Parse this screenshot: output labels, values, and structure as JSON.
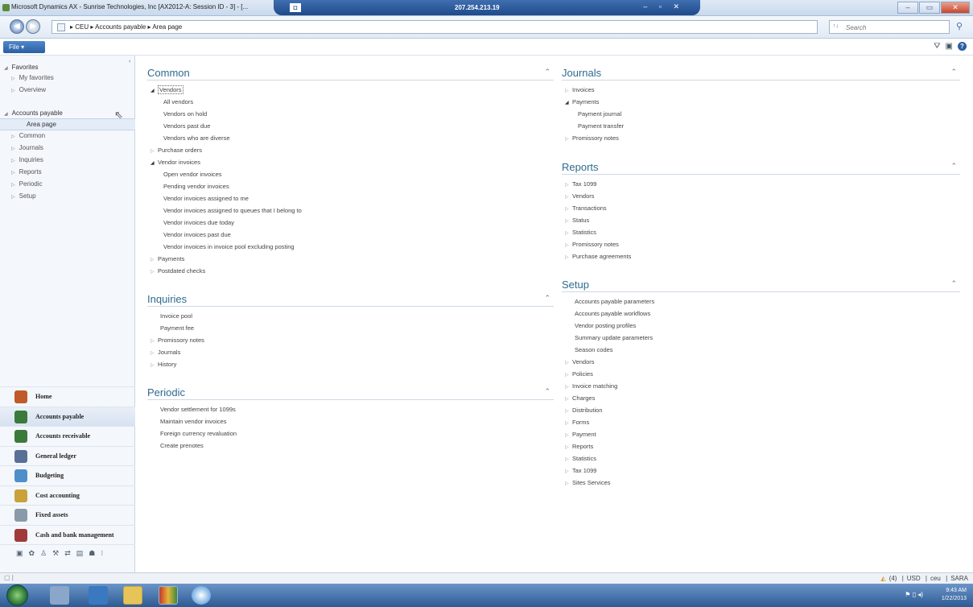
{
  "window": {
    "title": "Microsoft Dynamics AX - Sunrise Technologies, Inc [AX2012-A: Session ID - 3] - [...",
    "rdp_ip": "207.254.213.19",
    "controls": [
      "–",
      "▭",
      "✕"
    ]
  },
  "address": {
    "breadcrumb": "▸  CEU  ▸  Accounts payable  ▸  Area page",
    "search_placeholder": "Search"
  },
  "file_button": "File  ▾",
  "nav": {
    "favorites_group": "Favorites",
    "favorites_items": [
      "My favorites",
      "Overview"
    ],
    "module_group": "Accounts payable",
    "module_items": [
      "Area page",
      "Common",
      "Journals",
      "Inquiries",
      "Reports",
      "Periodic",
      "Setup"
    ]
  },
  "modules": [
    {
      "label": "Home",
      "color": "#c05a2a"
    },
    {
      "label": "Accounts payable",
      "color": "#3a7a3a"
    },
    {
      "label": "Accounts receivable",
      "color": "#3a7a3a"
    },
    {
      "label": "General ledger",
      "color": "#5a6f96"
    },
    {
      "label": "Budgeting",
      "color": "#4f8fc9"
    },
    {
      "label": "Cost accounting",
      "color": "#c9a23a"
    },
    {
      "label": "Fixed assets",
      "color": "#8a9aa8"
    },
    {
      "label": "Cash and bank management",
      "color": "#a03a3a"
    }
  ],
  "sections": {
    "common": {
      "title": "Common",
      "rows": [
        {
          "text": "Vendors",
          "level": "l0",
          "tri": "◢",
          "boxed": true
        },
        {
          "text": "All vendors",
          "level": "l1"
        },
        {
          "text": "Vendors on hold",
          "level": "l1"
        },
        {
          "text": "Vendors past due",
          "level": "l1"
        },
        {
          "text": "Vendors who are diverse",
          "level": "l1"
        },
        {
          "text": "Purchase orders",
          "level": "l0",
          "tri": "▷"
        },
        {
          "text": "Vendor invoices",
          "level": "l0",
          "tri": "◢"
        },
        {
          "text": "Open vendor invoices",
          "level": "l1"
        },
        {
          "text": "Pending vendor invoices",
          "level": "l1"
        },
        {
          "text": "Vendor invoices assigned to me",
          "level": "l1"
        },
        {
          "text": "Vendor invoices assigned to queues that I belong to",
          "level": "l1"
        },
        {
          "text": "Vendor invoices due today",
          "level": "l1"
        },
        {
          "text": "Vendor invoices past due",
          "level": "l1"
        },
        {
          "text": "Vendor invoices in invoice pool excluding posting",
          "level": "l1"
        },
        {
          "text": "Payments",
          "level": "l0",
          "tri": "▷"
        },
        {
          "text": "Postdated checks",
          "level": "l0",
          "tri": "▷"
        }
      ]
    },
    "inquiries": {
      "title": "Inquiries",
      "rows": [
        {
          "text": "Invoice pool",
          "level": "plain"
        },
        {
          "text": "Payment fee",
          "level": "plain"
        },
        {
          "text": "Promissory notes",
          "level": "l0",
          "tri": "▷"
        },
        {
          "text": "Journals",
          "level": "l0",
          "tri": "▷"
        },
        {
          "text": "History",
          "level": "l0",
          "tri": "▷"
        }
      ]
    },
    "periodic": {
      "title": "Periodic",
      "rows": [
        {
          "text": "Vendor settlement for 1099s",
          "level": "plain"
        },
        {
          "text": "Maintain vendor invoices",
          "level": "plain"
        },
        {
          "text": "Foreign currency revaluation",
          "level": "plain"
        },
        {
          "text": "Create prenotes",
          "level": "plain"
        }
      ]
    },
    "journals": {
      "title": "Journals",
      "rows": [
        {
          "text": "Invoices",
          "level": "l0",
          "tri": "▷"
        },
        {
          "text": "Payments",
          "level": "l0",
          "tri": "◢"
        },
        {
          "text": "Payment journal",
          "level": "l1"
        },
        {
          "text": "Payment transfer",
          "level": "l1"
        },
        {
          "text": "Promissory notes",
          "level": "l0",
          "tri": "▷"
        }
      ]
    },
    "reports": {
      "title": "Reports",
      "rows": [
        {
          "text": "Tax 1099",
          "level": "l0",
          "tri": "▷"
        },
        {
          "text": "Vendors",
          "level": "l0",
          "tri": "▷"
        },
        {
          "text": "Transactions",
          "level": "l0",
          "tri": "▷"
        },
        {
          "text": "Status",
          "level": "l0",
          "tri": "▷"
        },
        {
          "text": "Statistics",
          "level": "l0",
          "tri": "▷"
        },
        {
          "text": "Promissory notes",
          "level": "l0",
          "tri": "▷"
        },
        {
          "text": "Purchase agreements",
          "level": "l0",
          "tri": "▷"
        }
      ]
    },
    "setup": {
      "title": "Setup",
      "rows": [
        {
          "text": "Accounts payable parameters",
          "level": "plain"
        },
        {
          "text": "Accounts payable workflows",
          "level": "plain"
        },
        {
          "text": "Vendor posting profiles",
          "level": "plain"
        },
        {
          "text": "Summary update parameters",
          "level": "plain"
        },
        {
          "text": "Season codes",
          "level": "plain"
        },
        {
          "text": "Vendors",
          "level": "l0",
          "tri": "▷"
        },
        {
          "text": "Policies",
          "level": "l0",
          "tri": "▷"
        },
        {
          "text": "Invoice matching",
          "level": "l0",
          "tri": "▷"
        },
        {
          "text": "Charges",
          "level": "l0",
          "tri": "▷"
        },
        {
          "text": "Distribution",
          "level": "l0",
          "tri": "▷"
        },
        {
          "text": "Forms",
          "level": "l0",
          "tri": "▷"
        },
        {
          "text": "Payment",
          "level": "l0",
          "tri": "▷"
        },
        {
          "text": "Reports",
          "level": "l0",
          "tri": "▷"
        },
        {
          "text": "Statistics",
          "level": "l0",
          "tri": "▷"
        },
        {
          "text": "Tax 1099",
          "level": "l0",
          "tri": "▷"
        },
        {
          "text": "Sites Services",
          "level": "l0",
          "tri": "▷"
        }
      ]
    }
  },
  "status": {
    "notifications": "(4)",
    "currency": "USD",
    "company": "ceu",
    "user": "SARA"
  },
  "taskbar": {
    "time": "9:43 AM",
    "date": "1/22/2013"
  }
}
